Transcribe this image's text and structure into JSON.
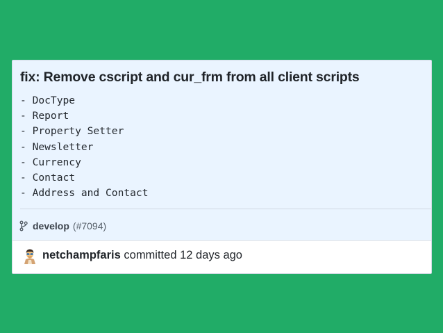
{
  "commit": {
    "title": "fix: Remove cscript and cur_frm from all client scripts",
    "body_lines": [
      "- DocType",
      "- Report",
      "- Property Setter",
      "- Newsletter",
      "- Currency",
      "- Contact",
      "- Address and Contact"
    ],
    "branch": "develop",
    "pr_ref": "(#7094)",
    "author": "netchampfaris",
    "action_text": "committed 12 days ago"
  },
  "icons": {
    "branch": "git-branch-icon",
    "avatar": "user-avatar"
  },
  "colors": {
    "background": "#21ac67",
    "card": "#eaf4ff",
    "footer": "#ffffff",
    "text": "#1f2328"
  }
}
